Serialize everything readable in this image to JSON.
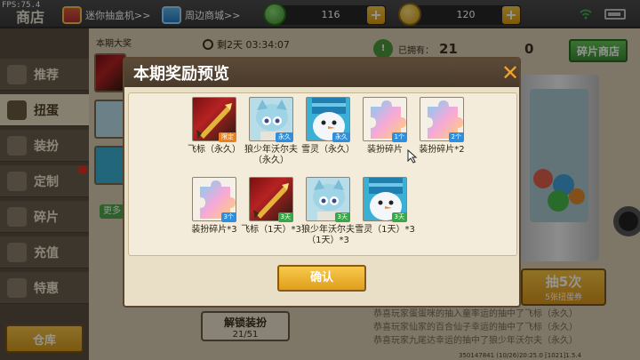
{
  "status": {
    "fps": "FPS:75.4"
  },
  "header": {
    "title": "商店",
    "gacha_link": "迷你抽盒机>>",
    "merch_link": "周边商城>>",
    "mini_beans": "116",
    "mini_coins": "120"
  },
  "sidebar": {
    "items": [
      {
        "label": "推荐"
      },
      {
        "label": "扭蛋"
      },
      {
        "label": "装扮"
      },
      {
        "label": "定制"
      },
      {
        "label": "碎片"
      },
      {
        "label": "充值"
      },
      {
        "label": "特惠"
      }
    ],
    "warehouse": "仓库"
  },
  "gacha": {
    "grand_prize_label": "本期大奖",
    "time_left": "剩2天 03:34:07",
    "more": "更多",
    "owned_label": "已拥有：",
    "owned_count": "21",
    "fragment_count": "0",
    "fragment_shop": "碎片商店",
    "draw5_label": "抽5次",
    "draw5_cost": "5张扭蛋券",
    "unlock_label": "解锁装扮",
    "unlock_progress": "21/51",
    "ticker": [
      "恭喜玩家蛋蛋咪的抽入童率运的抽中了飞标（永久）",
      "恭喜玩家仙家的百合仙子幸运的抽中了飞标（永久）",
      "恭喜玩家九尾达幸运的抽中了狼少年沃尔夫（永久）"
    ],
    "footer": "350147841  (10/26)20:25.0  [1021]1.5.4"
  },
  "modal": {
    "title": "本期奖励预览",
    "confirm": "确认",
    "items": [
      {
        "name": "飞标（永久）",
        "badge": "限定",
        "kind": "dart",
        "badge_color": "orange"
      },
      {
        "name": "狼少年沃尔夫（永久）",
        "badge": "永久",
        "kind": "wolf",
        "badge_color": "blue"
      },
      {
        "name": "雪灵（永久）",
        "badge": "永久",
        "kind": "snow",
        "badge_color": "blue"
      },
      {
        "name": "装扮碎片",
        "badge": "1个",
        "kind": "frag",
        "badge_color": "blue"
      },
      {
        "name": "装扮碎片*2",
        "badge": "2个",
        "kind": "frag",
        "badge_color": "blue"
      },
      {
        "name": "装扮碎片*3",
        "badge": "3个",
        "kind": "frag",
        "badge_color": "blue"
      },
      {
        "name": "飞标（1天）*3",
        "badge": "3天",
        "kind": "dart",
        "badge_color": "green"
      },
      {
        "name": "狼少年沃尔夫（1天）*3",
        "badge": "3天",
        "kind": "wolf",
        "badge_color": "green"
      },
      {
        "name": "雪灵（1天）*3",
        "badge": "3天",
        "kind": "snow",
        "badge_color": "green"
      }
    ]
  }
}
